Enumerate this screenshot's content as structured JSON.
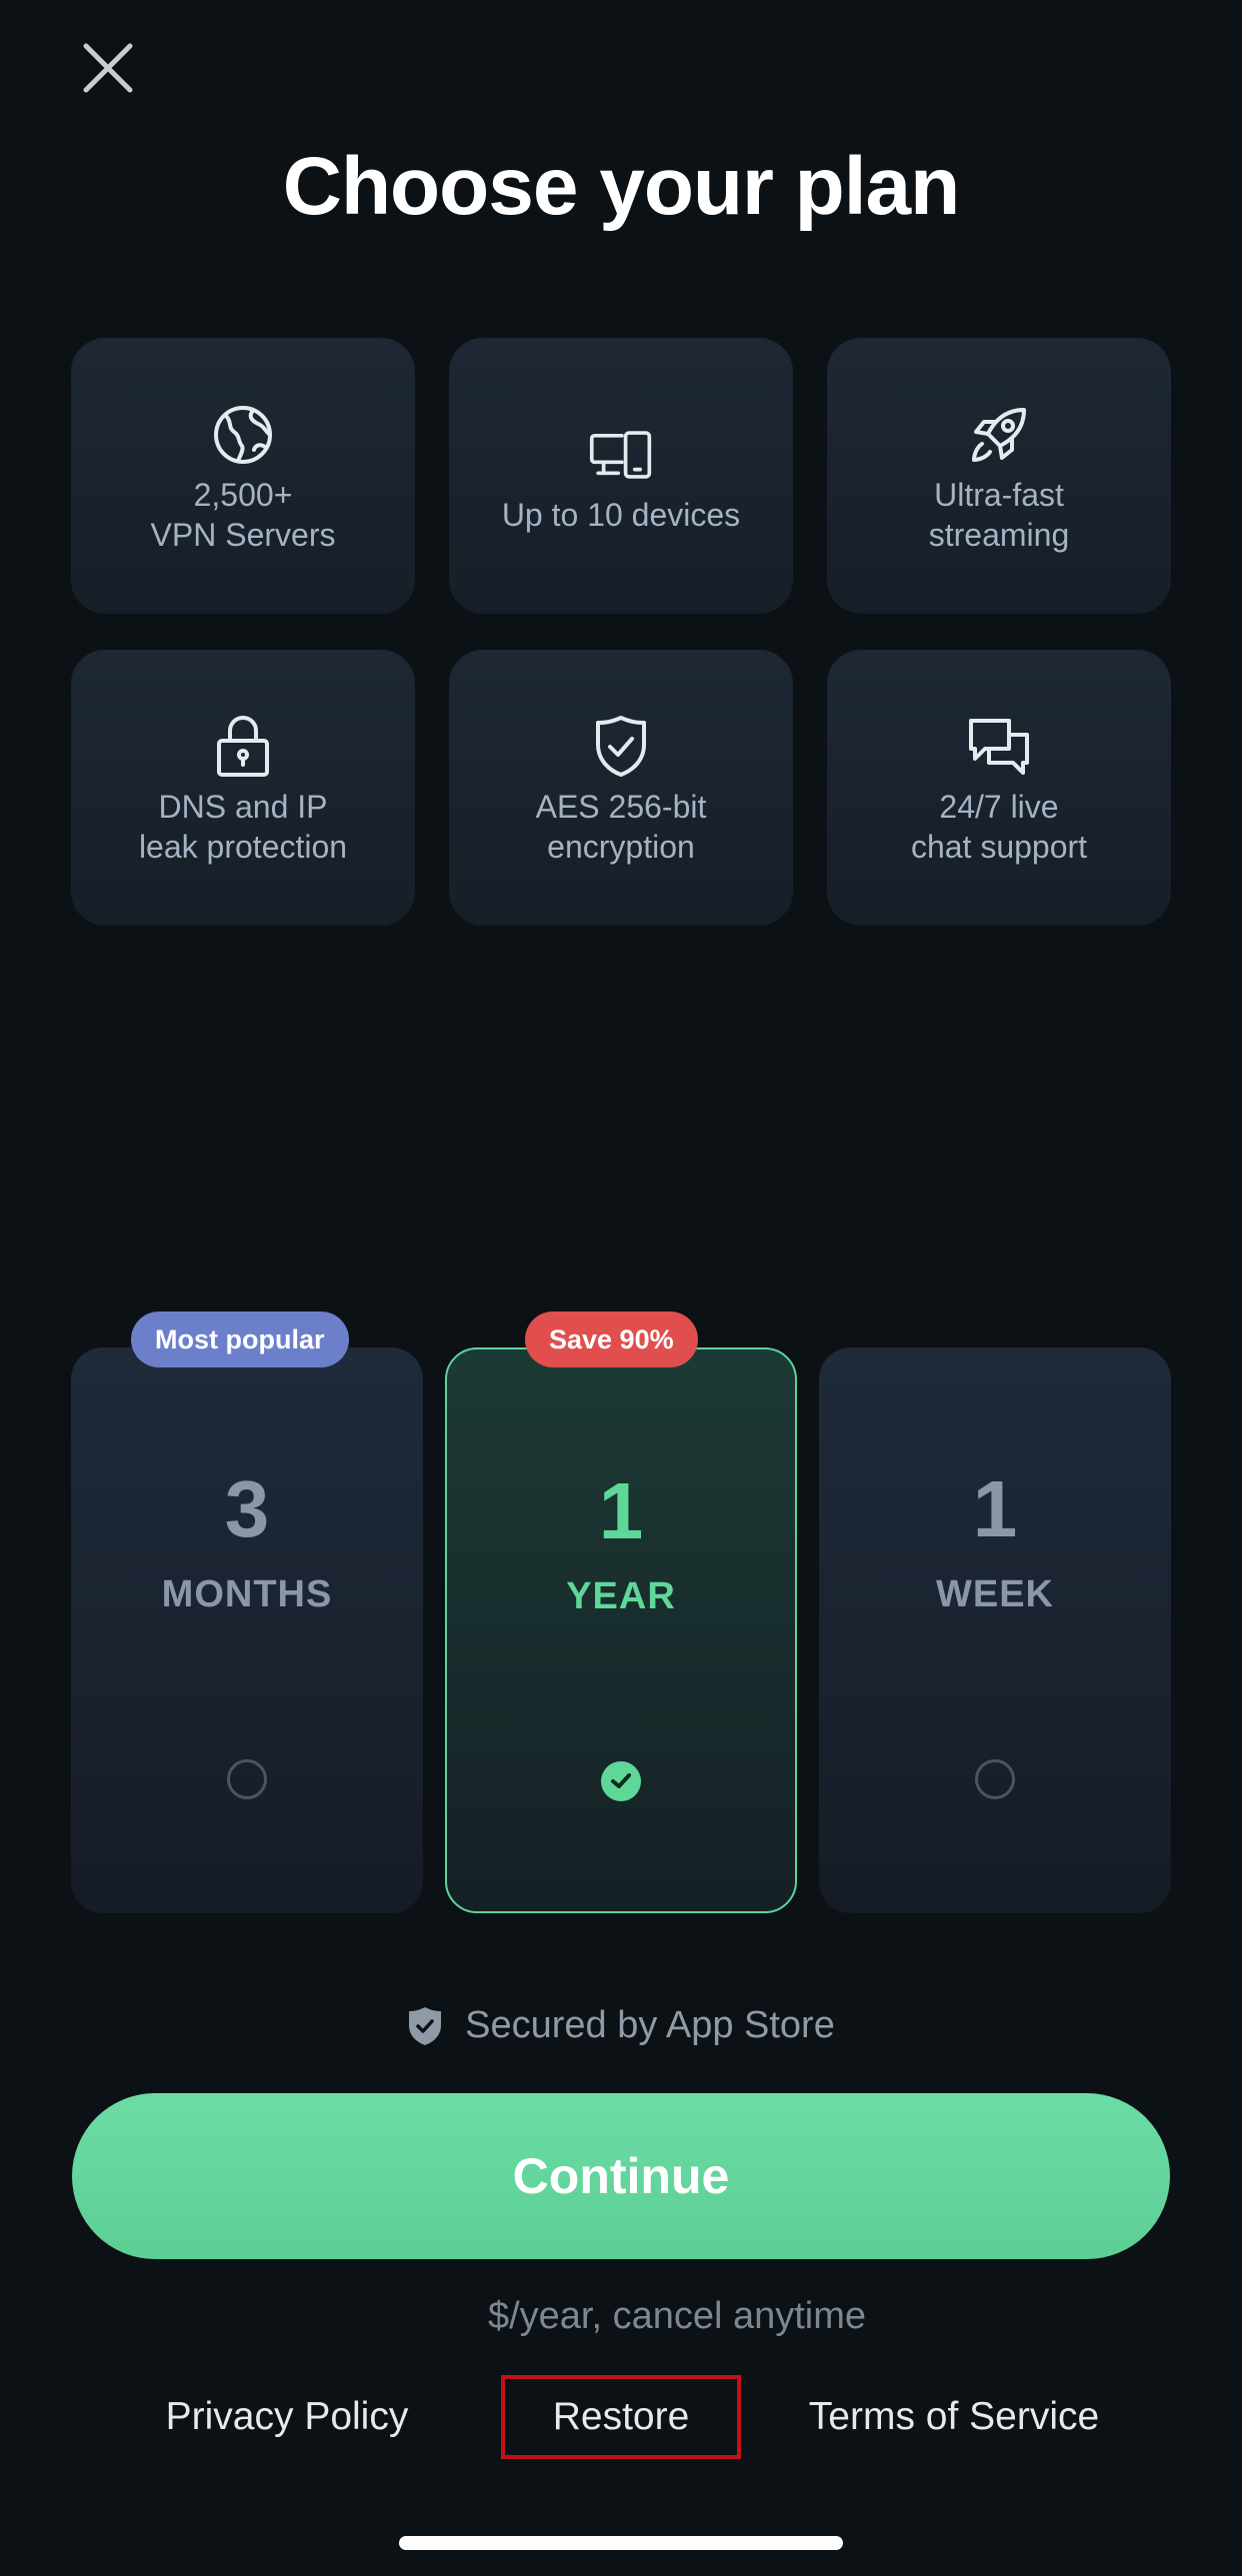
{
  "header": {
    "close_icon": "close-icon",
    "title": "Choose your plan"
  },
  "features": [
    {
      "icon": "globe-icon",
      "label": "2,500+\nVPN Servers"
    },
    {
      "icon": "devices-icon",
      "label": "Up to 10 devices"
    },
    {
      "icon": "rocket-icon",
      "label": "Ultra-fast\nstreaming"
    },
    {
      "icon": "lock-icon",
      "label": "DNS and IP\nleak protection"
    },
    {
      "icon": "shield-check-icon",
      "label": "AES 256-bit\nencryption"
    },
    {
      "icon": "chat-bubbles-icon",
      "label": "24/7 live\nchat support"
    }
  ],
  "plans": [
    {
      "number": "3",
      "unit": "MONTHS",
      "badge": "Most popular",
      "selected": false
    },
    {
      "number": "1",
      "unit": "YEAR",
      "badge": "Save 90%",
      "selected": true
    },
    {
      "number": "1",
      "unit": "WEEK",
      "badge": "",
      "selected": false
    }
  ],
  "secured_text": "Secured by App Store",
  "continue_label": "Continue",
  "price_note": "$/year, cancel anytime",
  "links": {
    "privacy": "Privacy Policy",
    "restore": "Restore",
    "terms": "Terms of Service"
  },
  "colors": {
    "background": "#0c1115",
    "accent": "#5fd799",
    "badge_popular": "#6c7fcb",
    "badge_save": "#e04e4e",
    "highlight_outline": "#c0121b"
  }
}
